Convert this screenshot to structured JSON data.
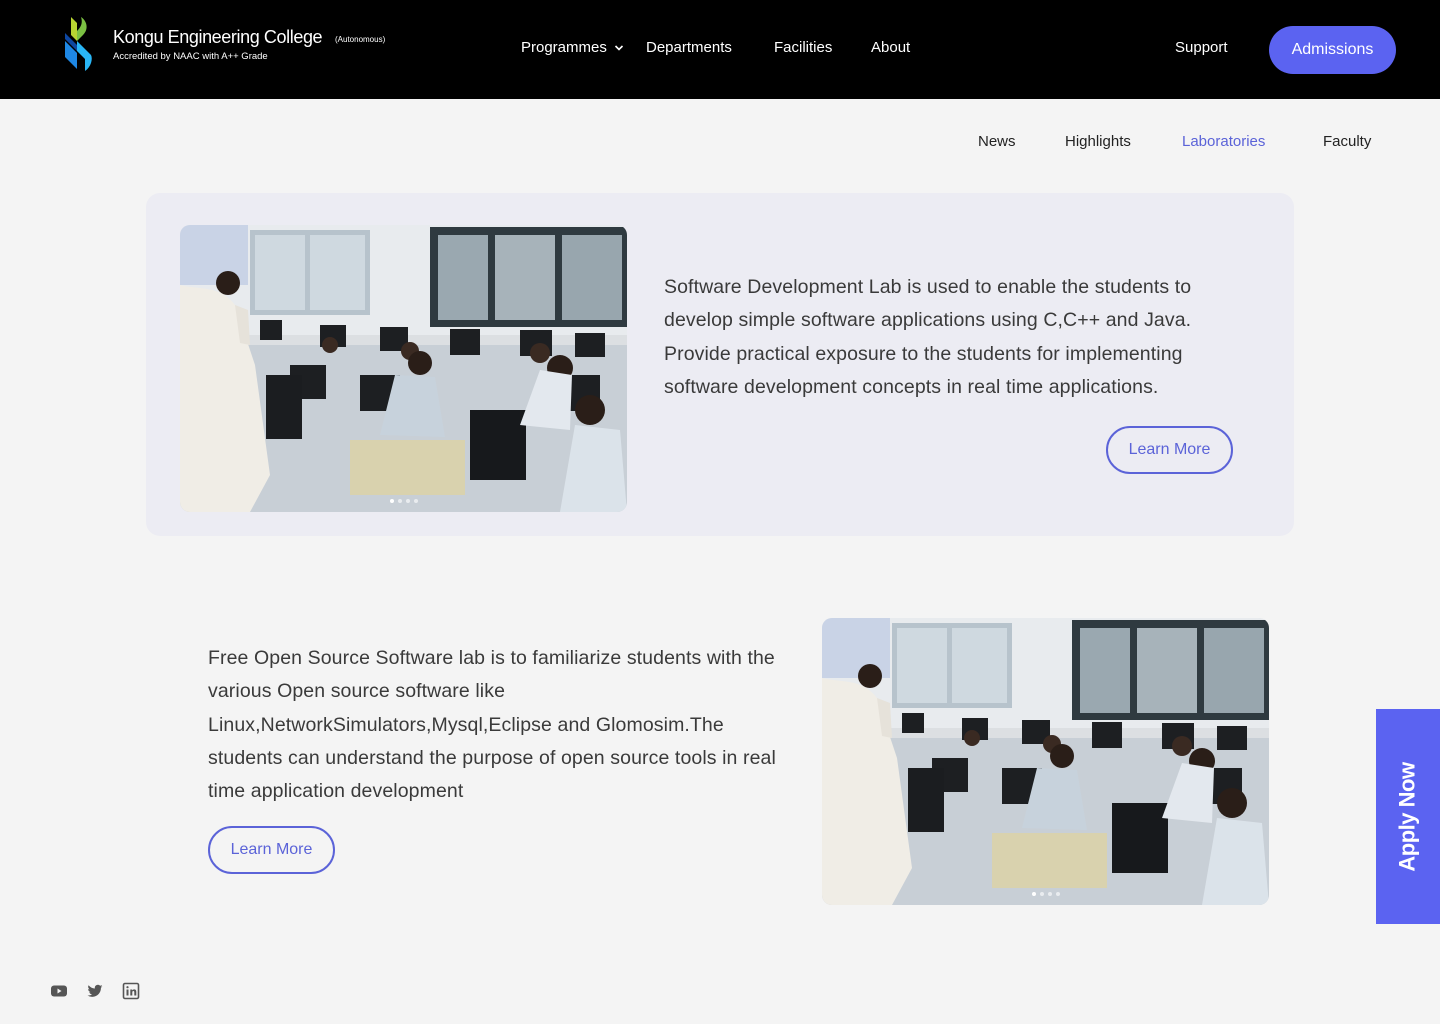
{
  "header": {
    "college_name": "Kongu Engineering College",
    "autonomous": "(Autonomous)",
    "accreditation": "Accredited by NAAC with A++ Grade",
    "nav": {
      "programmes": "Programmes",
      "departments": "Departments",
      "facilities": "Facilities",
      "about": "About"
    },
    "support": "Support",
    "admissions": "Admissions"
  },
  "tabs": {
    "news": "News",
    "highlights": "Highlights",
    "laboratories": "Laboratories",
    "faculty": "Faculty",
    "active": "Laboratories"
  },
  "labs": [
    {
      "description": "Software Development Lab is used to enable the students to develop simple software applications using C,C++ and Java. Provide practical exposure to the students for implementing software development concepts in real time applications.",
      "button": "Learn More",
      "carousel_slides": 4,
      "carousel_active": 1
    },
    {
      "description": "Free Open Source Software lab is to familiarize students with the various Open source software like Linux,NetworkSimulators,Mysql,Eclipse and Glomosim.The students can understand the purpose of open source tools in real time application development",
      "button": "Learn More",
      "carousel_slides": 4,
      "carousel_active": 1
    }
  ],
  "apply_now": "Apply Now",
  "social": [
    "youtube-icon",
    "twitter-icon",
    "linkedin-icon"
  ],
  "colors": {
    "accent": "#5b63f1",
    "header_bg": "#000000",
    "page_bg": "#f4f4f4",
    "card_bg": "#ececf3"
  }
}
